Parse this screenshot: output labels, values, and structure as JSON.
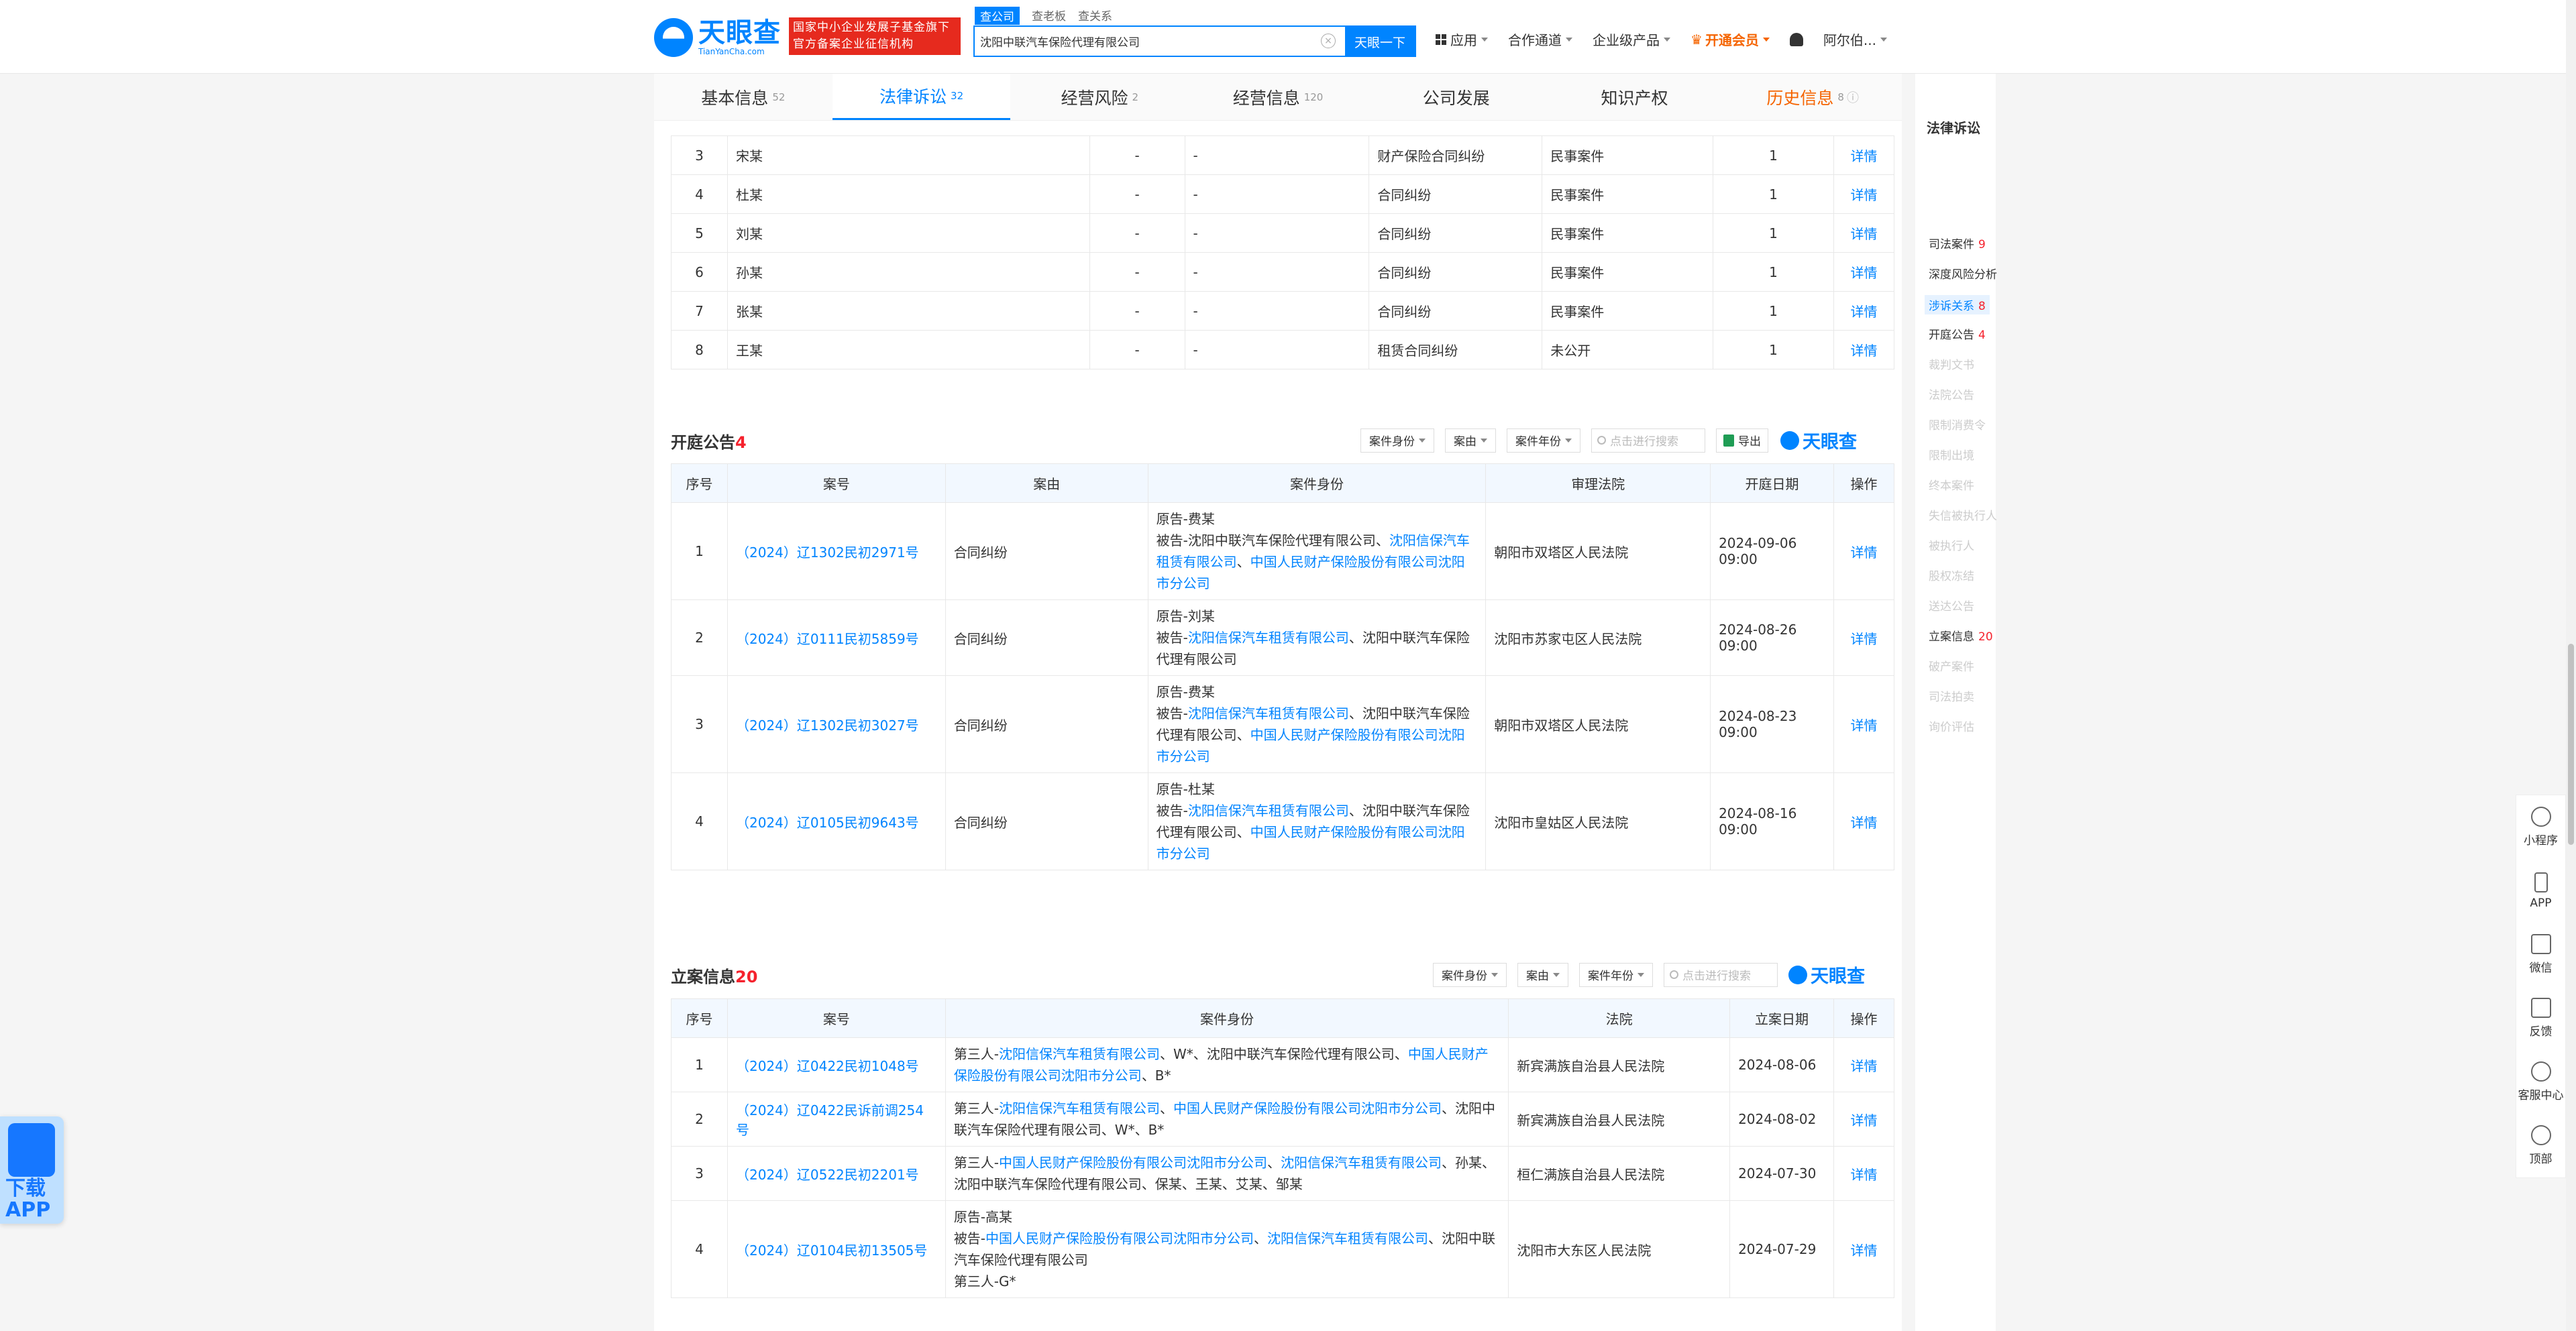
{
  "header": {
    "logo_cn": "天眼查",
    "logo_en": "TianYanCha.com",
    "gov_badge_line1": "国家中小企业发展子基金旗下",
    "gov_badge_line2": "官方备案企业征信机构",
    "search_tabs": [
      "查公司",
      "查老板",
      "查关系"
    ],
    "search_value": "沈阳中联汽车保险代理有限公司",
    "search_button": "天眼一下",
    "nav": [
      "应用",
      "合作通道",
      "企业级产品",
      "开通会员",
      "阿尔伯..."
    ]
  },
  "main_tabs": [
    {
      "label": "基本信息",
      "count": "52"
    },
    {
      "label": "法律诉讼",
      "count": "32"
    },
    {
      "label": "经营风险",
      "count": "2"
    },
    {
      "label": "经营信息",
      "count": "120"
    },
    {
      "label": "公司发展",
      "count": ""
    },
    {
      "label": "知识产权",
      "count": ""
    },
    {
      "label": "历史信息",
      "count": "8"
    }
  ],
  "related_table": {
    "rows": [
      {
        "no": "3",
        "name": "宋某",
        "c1": "-",
        "c2": "-",
        "reason": "财产保险合同纠纷",
        "type": "民事案件",
        "count": "1",
        "action": "详情"
      },
      {
        "no": "4",
        "name": "杜某",
        "c1": "-",
        "c2": "-",
        "reason": "合同纠纷",
        "type": "民事案件",
        "count": "1",
        "action": "详情"
      },
      {
        "no": "5",
        "name": "刘某",
        "c1": "-",
        "c2": "-",
        "reason": "合同纠纷",
        "type": "民事案件",
        "count": "1",
        "action": "详情"
      },
      {
        "no": "6",
        "name": "孙某",
        "c1": "-",
        "c2": "-",
        "reason": "合同纠纷",
        "type": "民事案件",
        "count": "1",
        "action": "详情"
      },
      {
        "no": "7",
        "name": "张某",
        "c1": "-",
        "c2": "-",
        "reason": "合同纠纷",
        "type": "民事案件",
        "count": "1",
        "action": "详情"
      },
      {
        "no": "8",
        "name": "王某",
        "c1": "-",
        "c2": "-",
        "reason": "租赁合同纠纷",
        "type": "未公开",
        "count": "1",
        "action": "详情"
      }
    ]
  },
  "court_notice": {
    "title": "开庭公告",
    "count": "4",
    "filters": [
      "案件身份",
      "案由",
      "案件年份"
    ],
    "search_placeholder": "点击进行搜索",
    "export": "导出",
    "brand": "天眼查",
    "headers": [
      "序号",
      "案号",
      "案由",
      "案件身份",
      "审理法院",
      "开庭日期",
      "操作"
    ],
    "rows": [
      {
        "no": "1",
        "case": "（2024）辽1302民初2971号",
        "reason": "合同纠纷",
        "p1": "原告-费某",
        "p2a": "被告-沈阳中联汽车保险代理有限公司、",
        "p2b": "沈阳信保汽车租赁有限公司",
        "p2c": "、",
        "p2d": "中国人民财产保险股份有限公司沈阳市分公司",
        "p2e": "",
        "court": "朝阳市双塔区人民法院",
        "date": "2024-09-06 09:00",
        "action": "详情"
      },
      {
        "no": "2",
        "case": "（2024）辽0111民初5859号",
        "reason": "合同纠纷",
        "p1": "原告-刘某",
        "p2a": "被告-",
        "p2b": "沈阳信保汽车租赁有限公司",
        "p2c": "、沈阳中联汽车保险代理有限公司",
        "p2d": "",
        "p2e": "",
        "court": "沈阳市苏家屯区人民法院",
        "date": "2024-08-26 09:00",
        "action": "详情"
      },
      {
        "no": "3",
        "case": "（2024）辽1302民初3027号",
        "reason": "合同纠纷",
        "p1": "原告-费某",
        "p2a": "被告-",
        "p2b": "沈阳信保汽车租赁有限公司",
        "p2c": "、沈阳中联汽车保险代理有限公司、",
        "p2d": "中国人民财产保险股份有限公司沈阳市分公司",
        "p2e": "",
        "court": "朝阳市双塔区人民法院",
        "date": "2024-08-23 09:00",
        "action": "详情"
      },
      {
        "no": "4",
        "case": "（2024）辽0105民初9643号",
        "reason": "合同纠纷",
        "p1": "原告-杜某",
        "p2a": "被告-",
        "p2b": "沈阳信保汽车租赁有限公司",
        "p2c": "、沈阳中联汽车保险代理有限公司、",
        "p2d": "中国人民财产保险股份有限公司沈阳市分公司",
        "p2e": "",
        "court": "沈阳市皇姑区人民法院",
        "date": "2024-08-16 09:00",
        "action": "详情"
      }
    ]
  },
  "filing_info": {
    "title": "立案信息",
    "count": "20",
    "filters": [
      "案件身份",
      "案由",
      "案件年份"
    ],
    "search_placeholder": "点击进行搜索",
    "brand": "天眼查",
    "headers": [
      "序号",
      "案号",
      "案件身份",
      "法院",
      "立案日期",
      "操作"
    ],
    "rows": [
      {
        "no": "1",
        "case": "（2024）辽0422民初1048号",
        "court": "新宾满族自治县人民法院",
        "date": "2024-08-06",
        "action": "详情",
        "party_html": [
          "第三人-",
          "沈阳信保汽车租赁有限公司",
          "、W*、沈阳中联汽车保险代理有限公司、",
          "中国人民财产保险股份有限公司沈阳市分公司",
          "、B*"
        ]
      },
      {
        "no": "2",
        "case": "（2024）辽0422民诉前调254号",
        "court": "新宾满族自治县人民法院",
        "date": "2024-08-02",
        "action": "详情",
        "party_html": [
          "第三人-",
          "沈阳信保汽车租赁有限公司",
          "、",
          "中国人民财产保险股份有限公司沈阳市分公司",
          "、沈阳中联汽车保险代理有限公司、W*、B*"
        ]
      },
      {
        "no": "3",
        "case": "（2024）辽0522民初2201号",
        "court": "桓仁满族自治县人民法院",
        "date": "2024-07-30",
        "action": "详情",
        "party_html": [
          "第三人-",
          "中国人民财产保险股份有限公司沈阳市分公司",
          "、",
          "沈阳信保汽车租赁有限公司",
          "、孙某、沈阳中联汽车保险代理有限公司、保某、王某、艾某、邹某"
        ]
      },
      {
        "no": "4",
        "case": "（2024）辽0104民初13505号",
        "court": "沈阳市大东区人民法院",
        "date": "2024-07-29",
        "action": "详情",
        "p1": "原告-高某",
        "p2": [
          "被告-",
          "中国人民财产保险股份有限公司沈阳市分公司",
          "、",
          "沈阳信保汽车租赁有限公司",
          "、沈阳中联汽车保险代理有限公司"
        ],
        "p3": "第三人-G*"
      }
    ]
  },
  "side_nav": {
    "title": "法律诉讼",
    "items": [
      {
        "label": "司法案件",
        "count": "9"
      },
      {
        "label": "深度风险分析",
        "count": ""
      },
      {
        "label": "涉诉关系",
        "count": "8"
      },
      {
        "label": "开庭公告",
        "count": "4"
      },
      {
        "label": "裁判文书",
        "count": ""
      },
      {
        "label": "法院公告",
        "count": ""
      },
      {
        "label": "限制消费令",
        "count": ""
      },
      {
        "label": "限制出境",
        "count": ""
      },
      {
        "label": "终本案件",
        "count": ""
      },
      {
        "label": "失信被执行人",
        "count": ""
      },
      {
        "label": "被执行人",
        "count": ""
      },
      {
        "label": "股权冻结",
        "count": ""
      },
      {
        "label": "送达公告",
        "count": ""
      },
      {
        "label": "立案信息",
        "count": "20"
      },
      {
        "label": "破产案件",
        "count": ""
      },
      {
        "label": "司法拍卖",
        "count": ""
      },
      {
        "label": "询价评估",
        "count": ""
      }
    ]
  },
  "right_float": [
    "小程序",
    "APP",
    "微信",
    "反馈",
    "客服中心",
    "顶部"
  ],
  "app_download": {
    "line1": "下载",
    "line2": "APP"
  }
}
